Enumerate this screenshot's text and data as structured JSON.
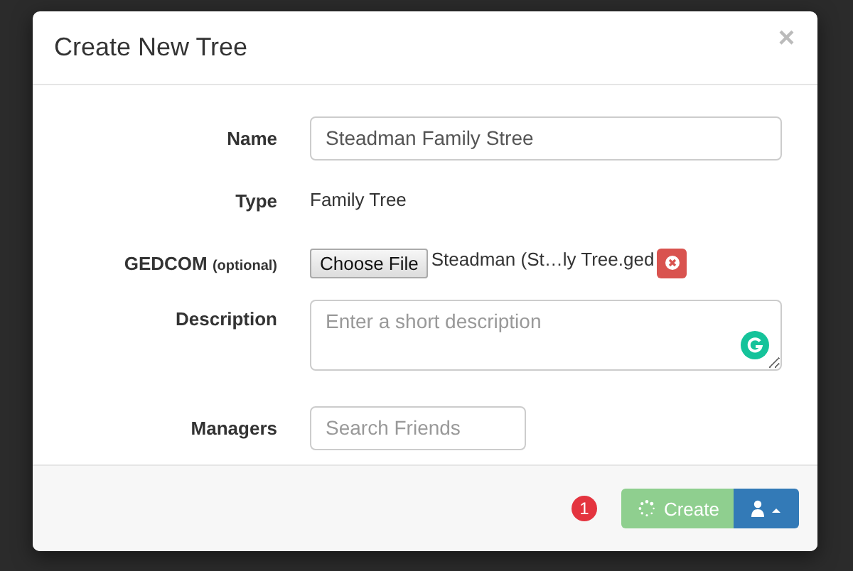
{
  "dialog": {
    "title": "Create New Tree",
    "close": "×",
    "fields": [
      {
        "kind": "input",
        "label": "Name",
        "value": "Steadman Family Stree"
      },
      {
        "kind": "static",
        "label": "Type",
        "value": "Family Tree"
      },
      {
        "kind": "file",
        "label": "GEDCOM",
        "label_note": "(optional)",
        "button": "Choose File",
        "value": "Steadman (St…ly Tree.ged"
      },
      {
        "kind": "textarea",
        "label": "Description",
        "placeholder": "Enter a short description"
      },
      {
        "kind": "input",
        "label": "Managers",
        "placeholder": "Search Friends"
      }
    ],
    "footer": {
      "badge": "1",
      "create": {
        "label": "Create",
        "disabled": true,
        "loading": true
      }
    }
  }
}
